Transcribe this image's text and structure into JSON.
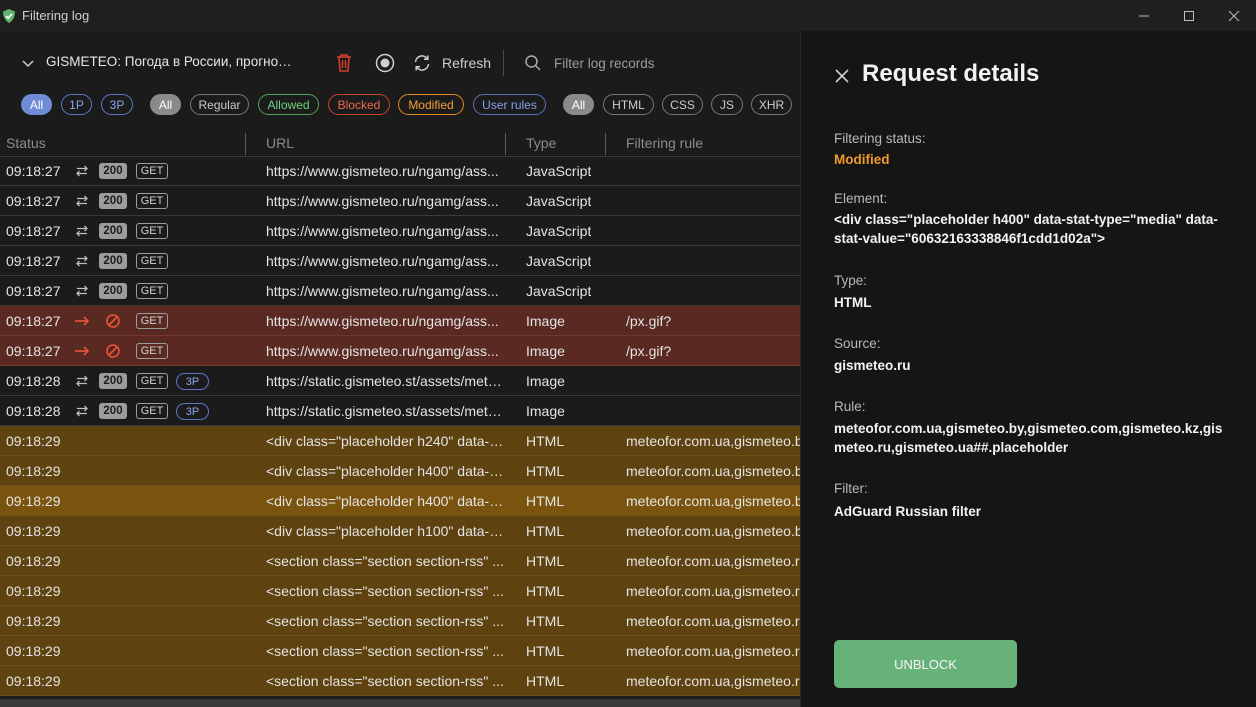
{
  "window": {
    "title": "Filtering log"
  },
  "toolbar": {
    "app_name": "GISMETEO: Погода в России, прогноз п...",
    "refresh_label": "Refresh",
    "search_placeholder": "Filter log records"
  },
  "filters": {
    "party": [
      "All",
      "1P",
      "3P"
    ],
    "status": [
      "All",
      "Regular",
      "Allowed",
      "Blocked",
      "Modified",
      "User rules"
    ],
    "content": [
      "All",
      "HTML",
      "CSS",
      "JS",
      "XHR"
    ]
  },
  "columns": {
    "status": "Status",
    "url": "URL",
    "type": "Type",
    "rule": "Filtering rule"
  },
  "rows": [
    {
      "time": "09:18:27",
      "kind": "ok",
      "code": "200",
      "method": "GET",
      "party": "",
      "url": "https://www.gismeteo.ru/ngamg/ass...",
      "type": "JavaScript",
      "rule": ""
    },
    {
      "time": "09:18:27",
      "kind": "ok",
      "code": "200",
      "method": "GET",
      "party": "",
      "url": "https://www.gismeteo.ru/ngamg/ass...",
      "type": "JavaScript",
      "rule": ""
    },
    {
      "time": "09:18:27",
      "kind": "ok",
      "code": "200",
      "method": "GET",
      "party": "",
      "url": "https://www.gismeteo.ru/ngamg/ass...",
      "type": "JavaScript",
      "rule": ""
    },
    {
      "time": "09:18:27",
      "kind": "ok",
      "code": "200",
      "method": "GET",
      "party": "",
      "url": "https://www.gismeteo.ru/ngamg/ass...",
      "type": "JavaScript",
      "rule": ""
    },
    {
      "time": "09:18:27",
      "kind": "ok",
      "code": "200",
      "method": "GET",
      "party": "",
      "url": "https://www.gismeteo.ru/ngamg/ass...",
      "type": "JavaScript",
      "rule": ""
    },
    {
      "time": "09:18:27",
      "kind": "blocked",
      "code": "",
      "method": "GET",
      "party": "",
      "url": "https://www.gismeteo.ru/ngamg/ass...",
      "type": "Image",
      "rule": "/px.gif?"
    },
    {
      "time": "09:18:27",
      "kind": "blocked",
      "code": "",
      "method": "GET",
      "party": "",
      "url": "https://www.gismeteo.ru/ngamg/ass...",
      "type": "Image",
      "rule": "/px.gif?"
    },
    {
      "time": "09:18:28",
      "kind": "ok",
      "code": "200",
      "method": "GET",
      "party": "3P",
      "url": "https://static.gismeteo.st/assets/meta...",
      "type": "Image",
      "rule": ""
    },
    {
      "time": "09:18:28",
      "kind": "ok",
      "code": "200",
      "method": "GET",
      "party": "3P",
      "url": "https://static.gismeteo.st/assets/meta...",
      "type": "Image",
      "rule": ""
    },
    {
      "time": "09:18:29",
      "kind": "modified",
      "code": "",
      "method": "",
      "party": "",
      "url": "<div class=\"placeholder h240\" data-s...",
      "type": "HTML",
      "rule": "meteofor.com.ua,gismeteo.b"
    },
    {
      "time": "09:18:29",
      "kind": "modified",
      "code": "",
      "method": "",
      "party": "",
      "url": "<div class=\"placeholder h400\" data-s...",
      "type": "HTML",
      "rule": "meteofor.com.ua,gismeteo.b"
    },
    {
      "time": "09:18:29",
      "kind": "modified-sel",
      "code": "",
      "method": "",
      "party": "",
      "url": "<div class=\"placeholder h400\" data-s...",
      "type": "HTML",
      "rule": "meteofor.com.ua,gismeteo.b"
    },
    {
      "time": "09:18:29",
      "kind": "modified",
      "code": "",
      "method": "",
      "party": "",
      "url": "<div class=\"placeholder h100\" data-s...",
      "type": "HTML",
      "rule": "meteofor.com.ua,gismeteo.b"
    },
    {
      "time": "09:18:29",
      "kind": "modified",
      "code": "",
      "method": "",
      "party": "",
      "url": "<section class=\"section section-rss\" ...",
      "type": "HTML",
      "rule": "meteofor.com.ua,gismeteo.r"
    },
    {
      "time": "09:18:29",
      "kind": "modified",
      "code": "",
      "method": "",
      "party": "",
      "url": "<section class=\"section section-rss\" ...",
      "type": "HTML",
      "rule": "meteofor.com.ua,gismeteo.r"
    },
    {
      "time": "09:18:29",
      "kind": "modified",
      "code": "",
      "method": "",
      "party": "",
      "url": "<section class=\"section section-rss\" ...",
      "type": "HTML",
      "rule": "meteofor.com.ua,gismeteo.r"
    },
    {
      "time": "09:18:29",
      "kind": "modified",
      "code": "",
      "method": "",
      "party": "",
      "url": "<section class=\"section section-rss\" ...",
      "type": "HTML",
      "rule": "meteofor.com.ua,gismeteo.r"
    },
    {
      "time": "09:18:29",
      "kind": "modified",
      "code": "",
      "method": "",
      "party": "",
      "url": "<section class=\"section section-rss\" ...",
      "type": "HTML",
      "rule": "meteofor.com.ua,gismeteo.r"
    }
  ],
  "details": {
    "title": "Request details",
    "status_label": "Filtering status:",
    "status_value": "Modified",
    "element_label": "Element:",
    "element_value": "<div class=\"placeholder h400\" data-stat-type=\"media\" data-stat-value=\"60632163338846f1cdd1d02a\">",
    "type_label": "Type:",
    "type_value": "HTML",
    "source_label": "Source:",
    "source_value": "gismeteo.ru",
    "rule_label": "Rule:",
    "rule_value": "meteofor.com.ua,gismeteo.by,gismeteo.com,gismeteo.kz,gismeteo.ru,gismeteo.ua##.placeholder",
    "filter_label": "Filter:",
    "filter_value": "AdGuard Russian filter",
    "unblock_label": "UNBLOCK"
  },
  "colors": {
    "accent_green": "#67b279",
    "modified": "#f19a2e",
    "blocked": "#f0684c"
  }
}
